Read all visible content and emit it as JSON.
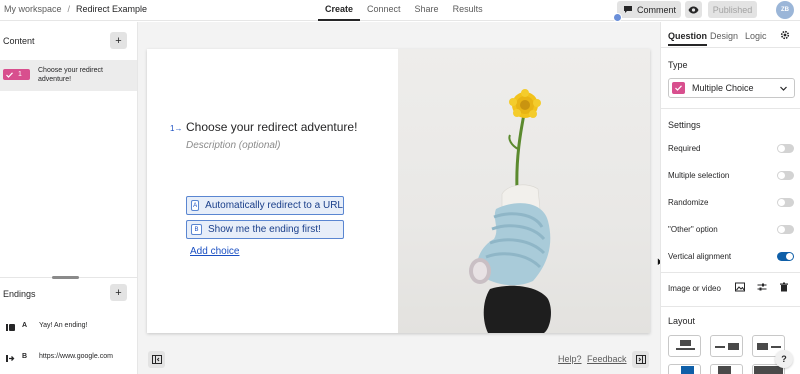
{
  "breadcrumb": {
    "workspace": "My workspace",
    "separator": "/",
    "form_name": "Redirect Example"
  },
  "nav_tabs": [
    {
      "label": "Create",
      "active": true
    },
    {
      "label": "Connect",
      "active": false
    },
    {
      "label": "Share",
      "active": false
    },
    {
      "label": "Results",
      "active": false
    }
  ],
  "header_actions": {
    "comment_label": "Comment",
    "publish_label": "Published",
    "avatar_initials": "ZB"
  },
  "content_panel": {
    "title": "Content",
    "add_label": "+",
    "questions": [
      {
        "label": "Choose your redirect adventure!",
        "chip_number": "1"
      }
    ]
  },
  "endings_panel": {
    "title": "Endings",
    "add_label": "+",
    "items": [
      {
        "letter": "A",
        "label": "Yay! An ending!"
      },
      {
        "letter": "B",
        "label": "https://www.google.com"
      }
    ]
  },
  "question": {
    "number": "1→",
    "title": "Choose your redirect adventure!",
    "description_placeholder": "Description (optional)",
    "choices": [
      {
        "key": "A",
        "label": "Automatically redirect to a URL"
      },
      {
        "key": "B",
        "label": "Show me the ending first!"
      }
    ],
    "add_choice_label": "Add choice"
  },
  "canvas_footer": {
    "help_label": "Help?",
    "feedback_label": "Feedback"
  },
  "right_panel": {
    "tabs": [
      {
        "label": "Question",
        "active": true
      },
      {
        "label": "Design",
        "active": false
      },
      {
        "label": "Logic",
        "active": false
      }
    ],
    "type_heading": "Type",
    "type_value": "Multiple Choice",
    "settings_heading": "Settings",
    "settings": [
      {
        "label": "Required",
        "on": false
      },
      {
        "label": "Multiple selection",
        "on": false
      },
      {
        "label": "Randomize",
        "on": false
      },
      {
        "label": "\"Other\" option",
        "on": false
      },
      {
        "label": "Vertical alignment",
        "on": true
      }
    ],
    "image_video_label": "Image or video",
    "layout_heading": "Layout"
  },
  "help_bubble": "?",
  "colors": {
    "accent_pink": "#d84f8e",
    "choice_blue": "#1a4fc2",
    "toggle_on": "#0f5fa8"
  }
}
